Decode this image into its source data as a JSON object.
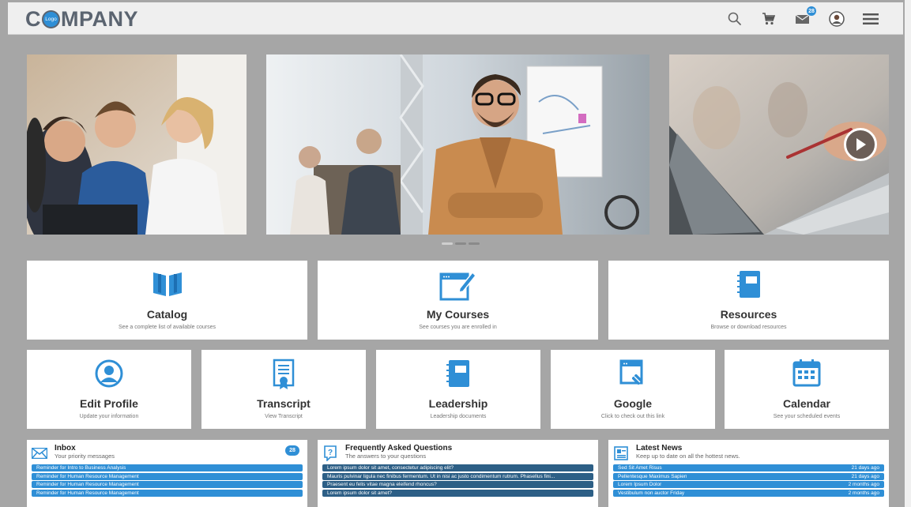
{
  "header": {
    "logo_text_left": "C",
    "logo_badge": "Logo",
    "logo_text_right": "MPANY",
    "messages_count": "28",
    "icons": [
      "search-icon",
      "cart-icon",
      "messages-icon",
      "avatar-icon",
      "menu-icon"
    ]
  },
  "carousel": {
    "slides": [
      "team-collaboration-photo",
      "smiling-man-photo",
      "laptop-video-photo"
    ],
    "active_dot": 0,
    "dot_count": 3
  },
  "tiles_row1": [
    {
      "title": "Catalog",
      "desc": "See a complete list of available courses",
      "icon": "book-icon"
    },
    {
      "title": "My Courses",
      "desc": "See courses you are enrolled in",
      "icon": "courses-window-icon"
    },
    {
      "title": "Resources",
      "desc": "Browse or download resources",
      "icon": "notebook-icon"
    }
  ],
  "tiles_row2": [
    {
      "title": "Edit Profile",
      "desc": "Update your information",
      "icon": "profile-icon"
    },
    {
      "title": "Transcript",
      "desc": "View Transcript",
      "icon": "certificate-icon"
    },
    {
      "title": "Leadership",
      "desc": "Leadership documents",
      "icon": "notebook-icon"
    },
    {
      "title": "Google",
      "desc": "Click to check out this link",
      "icon": "link-window-icon"
    },
    {
      "title": "Calendar",
      "desc": "See your scheduled events",
      "icon": "calendar-icon"
    }
  ],
  "inbox": {
    "title": "Inbox",
    "subtitle": "Your priority messages",
    "count": "28",
    "items": [
      "Reminder for Intro to Business Analysis",
      "Reminder for Human Resource Management",
      "Reminder for Human Resource Management",
      "Reminder for Human Resource Management"
    ]
  },
  "faq": {
    "title": "Frequently Asked Questions",
    "subtitle": "The answers to your questions",
    "items": [
      "Lorem ipsum dolor sit amet, consectetur adipiscing elit?",
      "Mauris pulvinar ligula nec finibus fermentum. Ut in nisi ac justo condimentum rutrum. Phasellus fini...",
      "Praesent eu felis vitae magna eleifend rhoncus?",
      "Lorem ipsum dolor sit amet?"
    ]
  },
  "news": {
    "title": "Latest News",
    "subtitle": "Keep up to date on all the hottest news.",
    "items": [
      {
        "text": "Sed Sit Amet Risus",
        "when": "21 days ago"
      },
      {
        "text": "Pellentesque Maximus Sapien",
        "when": "21 days ago"
      },
      {
        "text": "Lorem Ipsum Dolor",
        "when": "2 months ago"
      },
      {
        "text": "Vestibulum non auctor Friday",
        "when": "2 months ago"
      }
    ]
  },
  "colors": {
    "accent": "#2f8fd6",
    "dark_accent": "#2d5f86",
    "background": "#a6a6a6",
    "header": "#efefef"
  }
}
